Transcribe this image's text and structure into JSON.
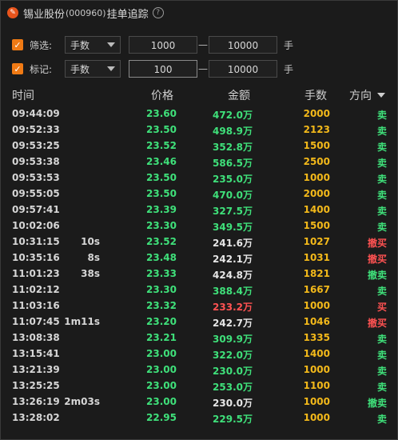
{
  "title": {
    "name": "锡业股份",
    "code": "(000960)",
    "suffix": "挂单追踪",
    "help": "?"
  },
  "filters": [
    {
      "label": "筛选:",
      "checked": true,
      "unit_select": "手数",
      "min": "1000",
      "max": "10000",
      "unit": "手"
    },
    {
      "label": "标记:",
      "checked": true,
      "unit_select": "手数",
      "min": "100",
      "max": "10000",
      "unit": "手"
    }
  ],
  "table": {
    "headers": {
      "time": "时间",
      "price": "价格",
      "amount": "金额",
      "volume": "手数",
      "direction": "方向"
    },
    "rows": [
      {
        "time": "09:44:09",
        "dur": "",
        "price": "23.60",
        "amount": "472.0万",
        "amount_color": "green",
        "volume": "2000",
        "dir": "卖",
        "dir_color": "green"
      },
      {
        "time": "09:52:33",
        "dur": "",
        "price": "23.50",
        "amount": "498.9万",
        "amount_color": "green",
        "volume": "2123",
        "dir": "卖",
        "dir_color": "green"
      },
      {
        "time": "09:53:25",
        "dur": "",
        "price": "23.52",
        "amount": "352.8万",
        "amount_color": "green",
        "volume": "1500",
        "dir": "卖",
        "dir_color": "green"
      },
      {
        "time": "09:53:38",
        "dur": "",
        "price": "23.46",
        "amount": "586.5万",
        "amount_color": "green",
        "volume": "2500",
        "dir": "卖",
        "dir_color": "green"
      },
      {
        "time": "09:53:53",
        "dur": "",
        "price": "23.50",
        "amount": "235.0万",
        "amount_color": "green",
        "volume": "1000",
        "dir": "卖",
        "dir_color": "green"
      },
      {
        "time": "09:55:05",
        "dur": "",
        "price": "23.50",
        "amount": "470.0万",
        "amount_color": "green",
        "volume": "2000",
        "dir": "卖",
        "dir_color": "green"
      },
      {
        "time": "09:57:41",
        "dur": "",
        "price": "23.39",
        "amount": "327.5万",
        "amount_color": "green",
        "volume": "1400",
        "dir": "卖",
        "dir_color": "green"
      },
      {
        "time": "10:02:06",
        "dur": "",
        "price": "23.30",
        "amount": "349.5万",
        "amount_color": "green",
        "volume": "1500",
        "dir": "卖",
        "dir_color": "green"
      },
      {
        "time": "10:31:15",
        "dur": "10s",
        "price": "23.52",
        "amount": "241.6万",
        "amount_color": "white",
        "volume": "1027",
        "dir": "撤买",
        "dir_color": "red"
      },
      {
        "time": "10:35:16",
        "dur": "8s",
        "price": "23.48",
        "amount": "242.1万",
        "amount_color": "white",
        "volume": "1031",
        "dir": "撤买",
        "dir_color": "red"
      },
      {
        "time": "11:01:23",
        "dur": "38s",
        "price": "23.33",
        "amount": "424.8万",
        "amount_color": "white",
        "volume": "1821",
        "dir": "撤卖",
        "dir_color": "green"
      },
      {
        "time": "11:02:12",
        "dur": "",
        "price": "23.30",
        "amount": "388.4万",
        "amount_color": "green",
        "volume": "1667",
        "dir": "卖",
        "dir_color": "green"
      },
      {
        "time": "11:03:16",
        "dur": "",
        "price": "23.32",
        "amount": "233.2万",
        "amount_color": "red",
        "volume": "1000",
        "dir": "买",
        "dir_color": "red"
      },
      {
        "time": "11:07:45",
        "dur": "1m11s",
        "price": "23.20",
        "amount": "242.7万",
        "amount_color": "white",
        "volume": "1046",
        "dir": "撤买",
        "dir_color": "red"
      },
      {
        "time": "13:08:38",
        "dur": "",
        "price": "23.21",
        "amount": "309.9万",
        "amount_color": "green",
        "volume": "1335",
        "dir": "卖",
        "dir_color": "green"
      },
      {
        "time": "13:15:41",
        "dur": "",
        "price": "23.00",
        "amount": "322.0万",
        "amount_color": "green",
        "volume": "1400",
        "dir": "卖",
        "dir_color": "green"
      },
      {
        "time": "13:21:39",
        "dur": "",
        "price": "23.00",
        "amount": "230.0万",
        "amount_color": "green",
        "volume": "1000",
        "dir": "卖",
        "dir_color": "green"
      },
      {
        "time": "13:25:25",
        "dur": "",
        "price": "23.00",
        "amount": "253.0万",
        "amount_color": "green",
        "volume": "1100",
        "dir": "卖",
        "dir_color": "green"
      },
      {
        "time": "13:26:19",
        "dur": "2m03s",
        "price": "23.00",
        "amount": "230.0万",
        "amount_color": "white",
        "volume": "1000",
        "dir": "撤卖",
        "dir_color": "green"
      },
      {
        "time": "13:28:02",
        "dur": "",
        "price": "22.95",
        "amount": "229.5万",
        "amount_color": "green",
        "volume": "1000",
        "dir": "卖",
        "dir_color": "green"
      }
    ]
  }
}
